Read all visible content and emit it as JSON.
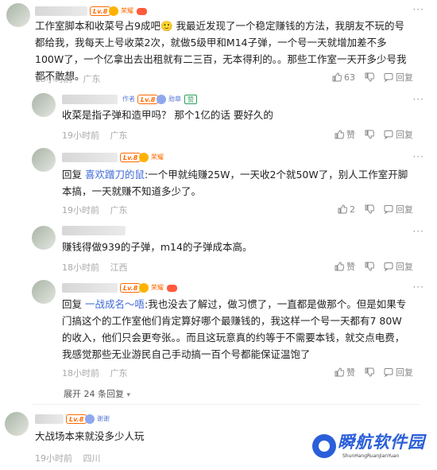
{
  "comments": [
    {
      "level": "Lv.8",
      "tag": "荣耀",
      "text": "工作室脚本和收菜号占9成吧🙂 我最近发现了一个稳定赚钱的方法，我朋友不玩的号都给我，我每天上号收菜2次，就做5级甲和M14子弹，一个号一天就增加差不多100W了，一个亿拿出去出租就有二三百，无本得利的。。那些工作室一天开多少号我都不敢想。",
      "time": "19小时前",
      "location": "广东",
      "likes": "63",
      "reply_label": "回复"
    },
    {
      "tag_author": "作者",
      "level": "Lv.8",
      "tag": "勋章",
      "tag2": "赞",
      "text": "收菜是指子弹和造甲吗？ 那个1亿的话 要好久的",
      "time": "19小时前",
      "location": "广东",
      "likes": "赞",
      "reply_label": "回复"
    },
    {
      "level": "Lv.8",
      "tag": "荣耀",
      "reply_prefix": "回复",
      "mention": "喜欢蹭刀的鼠",
      "text": ":一个甲就纯赚25W，一天收2个就50W了，别人工作室开脚本搞，一天就赚不知道多少了。",
      "time": "19小时前",
      "location": "广东",
      "likes": "2",
      "reply_label": "回复"
    },
    {
      "text": "赚钱得做939的子弹，m14的子弹成本高。",
      "time": "18小时前",
      "location": "江西",
      "likes": "赞",
      "reply_label": "回复"
    },
    {
      "level": "Lv.8",
      "tag": "荣耀",
      "reply_prefix": "回复",
      "mention": "一战成名～唔",
      "text": ":我也没去了解过，做习惯了，一直都是做那个。但是如果专门搞这个的工作室他们肯定算好哪个最赚钱的，我这样一个号一天都有7 80W的收入，他们只会更夸张。。而且这玩意真的约等于不需要本钱，就交点电费，我感觉那些无业游民自己手动搞一百个号都能保证温饱了",
      "time": "18小时前",
      "location": "广东",
      "likes": "赞",
      "reply_label": "回复"
    },
    {
      "level": "Lv.8",
      "tag": "谢谢",
      "text": "大战场本来就没多少人玩",
      "time": "19小时前",
      "location": "四川"
    }
  ],
  "expand_label": "展开 24 条回复",
  "watermark": {
    "title": "瞬航软件园",
    "subtitle": "ShunHangRuanJianYuan"
  },
  "colors": {
    "accent": "#ff6a00",
    "link": "#3f6ad8",
    "meta": "#aaaaaa"
  }
}
